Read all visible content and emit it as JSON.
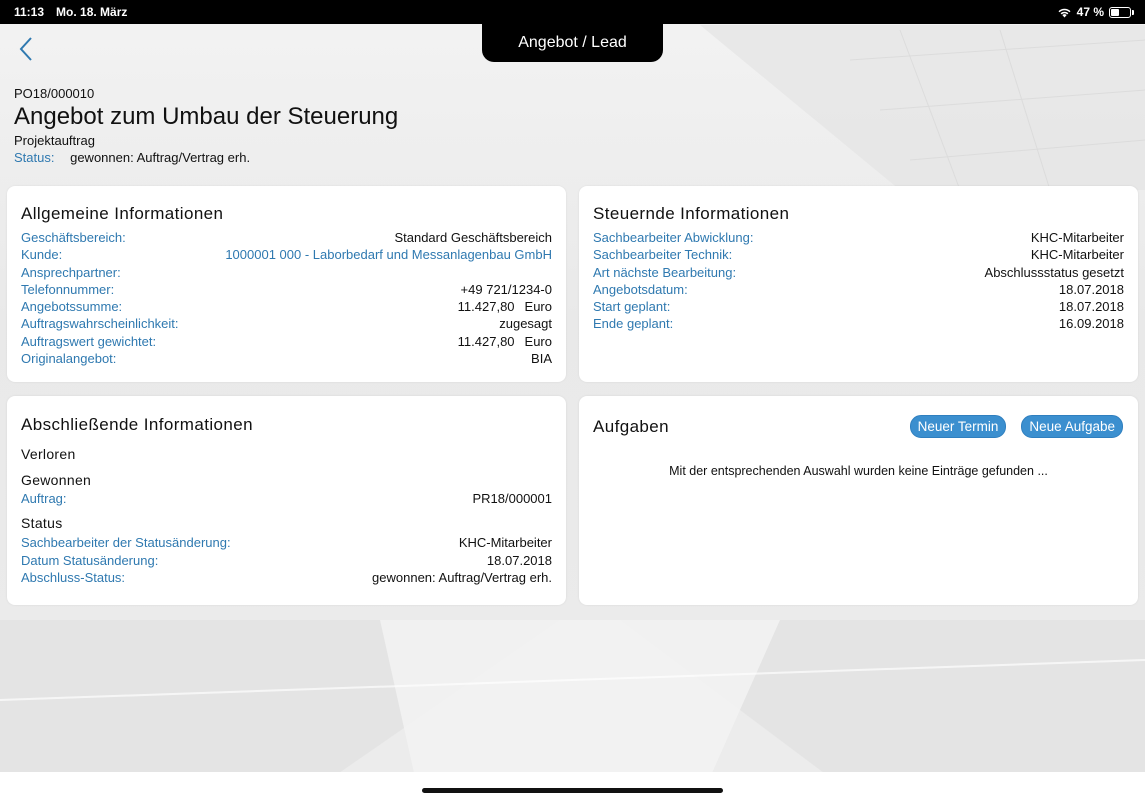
{
  "statusbar": {
    "time": "11:13",
    "date": "Mo. 18. März",
    "battery": "47 %",
    "battery_level": 0.47
  },
  "nav": {
    "title": "Angebot / Lead",
    "back_icon": "chevron-left-icon"
  },
  "header": {
    "code": "PO18/000010",
    "title": "Angebot zum Umbau der Steuerung",
    "type": "Projektauftrag",
    "status_label": "Status:",
    "status_value": "gewonnen: Auftrag/Vertrag erh."
  },
  "allgemein": {
    "title": "Allgemeine Informationen",
    "rows": [
      {
        "label": "Geschäftsbereich:",
        "value": "Standard Geschäftsbereich"
      },
      {
        "label": "Kunde:",
        "value": "1000001 000 - Laborbedarf und Messanlagenbau GmbH"
      },
      {
        "label": "Ansprechpartner:",
        "value": ""
      },
      {
        "label": "Telefonnummer:",
        "value": "+49 721/1234-0"
      },
      {
        "label": "Angebotssumme:",
        "value": "11.427,80",
        "unit": "Euro"
      },
      {
        "label": "Auftragswahrscheinlichkeit:",
        "value": "zugesagt"
      },
      {
        "label": "Auftragswert gewichtet:",
        "value": "11.427,80",
        "unit": "Euro"
      },
      {
        "label": "Originalangebot:",
        "value": "BIA"
      }
    ]
  },
  "steuernd": {
    "title": "Steuernde Informationen",
    "rows": [
      {
        "label": "Sachbearbeiter Abwicklung:",
        "value": "KHC-Mitarbeiter"
      },
      {
        "label": "Sachbearbeiter Technik:",
        "value": "KHC-Mitarbeiter"
      },
      {
        "label": "Art nächste Bearbeitung:",
        "value": "Abschlussstatus gesetzt"
      },
      {
        "label": "Angebotsdatum:",
        "value": "18.07.2018"
      },
      {
        "label": "Start geplant:",
        "value": "18.07.2018"
      },
      {
        "label": "Ende geplant:",
        "value": "16.09.2018"
      }
    ]
  },
  "abschluss": {
    "title": "Abschließende Informationen",
    "verloren": "Verloren",
    "gewonnen": "Gewonnen",
    "auftrag_label": "Auftrag:",
    "auftrag_value": "PR18/000001",
    "status_title": "Status",
    "rows": [
      {
        "label": "Sachbearbeiter der Statusänderung:",
        "value": "KHC-Mitarbeiter"
      },
      {
        "label": "Datum Statusänderung:",
        "value": "18.07.2018"
      },
      {
        "label": "Abschluss-Status:",
        "value": "gewonnen: Auftrag/Vertrag erh."
      }
    ]
  },
  "aufgaben": {
    "title": "Aufgaben",
    "btn_termin": "Neuer Termin",
    "btn_aufgabe": "Neue Aufgabe",
    "empty": "Mit der entsprechenden Auswahl wurden keine Einträge gefunden ..."
  },
  "colors": {
    "accent": "#2f79b0",
    "button": "#3b8fcf"
  }
}
